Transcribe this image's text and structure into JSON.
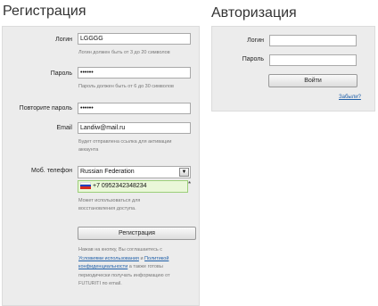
{
  "registration": {
    "title": "Регистрация",
    "login_label": "Логин",
    "login_value": "LGGGG",
    "login_hint": "Логин должен быть от 3 до 20 символов",
    "password_label": "Пароль",
    "password_value": "••••••",
    "password_hint": "Пароль должен быть от 6 до 30 символов",
    "repeat_label": "Повторите пароль",
    "repeat_value": "••••••",
    "email_label": "Email",
    "email_value": "Landiw@mail.ru",
    "email_hint_1": "Будет отправлена ссылка для активации",
    "email_hint_2": "аккаунта",
    "phone_label": "Моб. телефон",
    "country_value": "Russian Federation",
    "phone_value": "+7 0952342348234",
    "phone_required_mark": "*",
    "phone_hint_1": "Может использоваться для",
    "phone_hint_2": "восстановления доступа.",
    "submit_label": "Регистрация",
    "terms_1": "Нажав на кнопку, Вы соглашаетесь с",
    "terms_link_1": "Условиями использования",
    "terms_and": "и",
    "terms_link_2a": "Политикой",
    "terms_link_2b": "конфиденциальности",
    "terms_3": "а также готовы",
    "terms_4": "периодически получать информацию от",
    "terms_5": "FUTURITI по email."
  },
  "auth": {
    "title": "Авторизация",
    "login_label": "Логин",
    "password_label": "Пароль",
    "submit_label": "Войти",
    "forgot_link": "Забыли?"
  },
  "colors": {
    "panel": "#ececec",
    "phone_highlight": "#eaf7d9",
    "link": "#1f5fa8"
  }
}
